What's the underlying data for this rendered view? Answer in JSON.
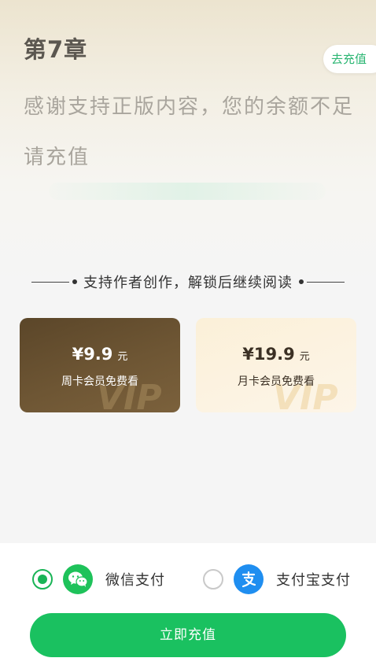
{
  "chapter": {
    "title": "第7章"
  },
  "header": {
    "recharge_label": "去充值"
  },
  "notice": {
    "message": "感谢支持正版内容，您的余额不足请充值"
  },
  "divider": {
    "text": "支持作者创作，解锁后继续阅读"
  },
  "vip_cards": [
    {
      "price": "¥9.9",
      "unit": "元",
      "description": "周卡会员免费看",
      "watermark": "VIP"
    },
    {
      "price": "¥19.9",
      "unit": "元",
      "description": "月卡会员免费看",
      "watermark": "VIP"
    }
  ],
  "payment": {
    "options": [
      {
        "label": "微信支付",
        "icon": "wechat-icon",
        "selected": true,
        "color": "#1ec25a"
      },
      {
        "label": "支付宝支付",
        "icon": "alipay-icon",
        "selected": false,
        "color": "#1f8ef0"
      }
    ],
    "submit_label": "立即充值"
  },
  "colors": {
    "accent": "#1ac160",
    "recharge_text": "#2bb673",
    "alipay": "#1f8ef0"
  }
}
